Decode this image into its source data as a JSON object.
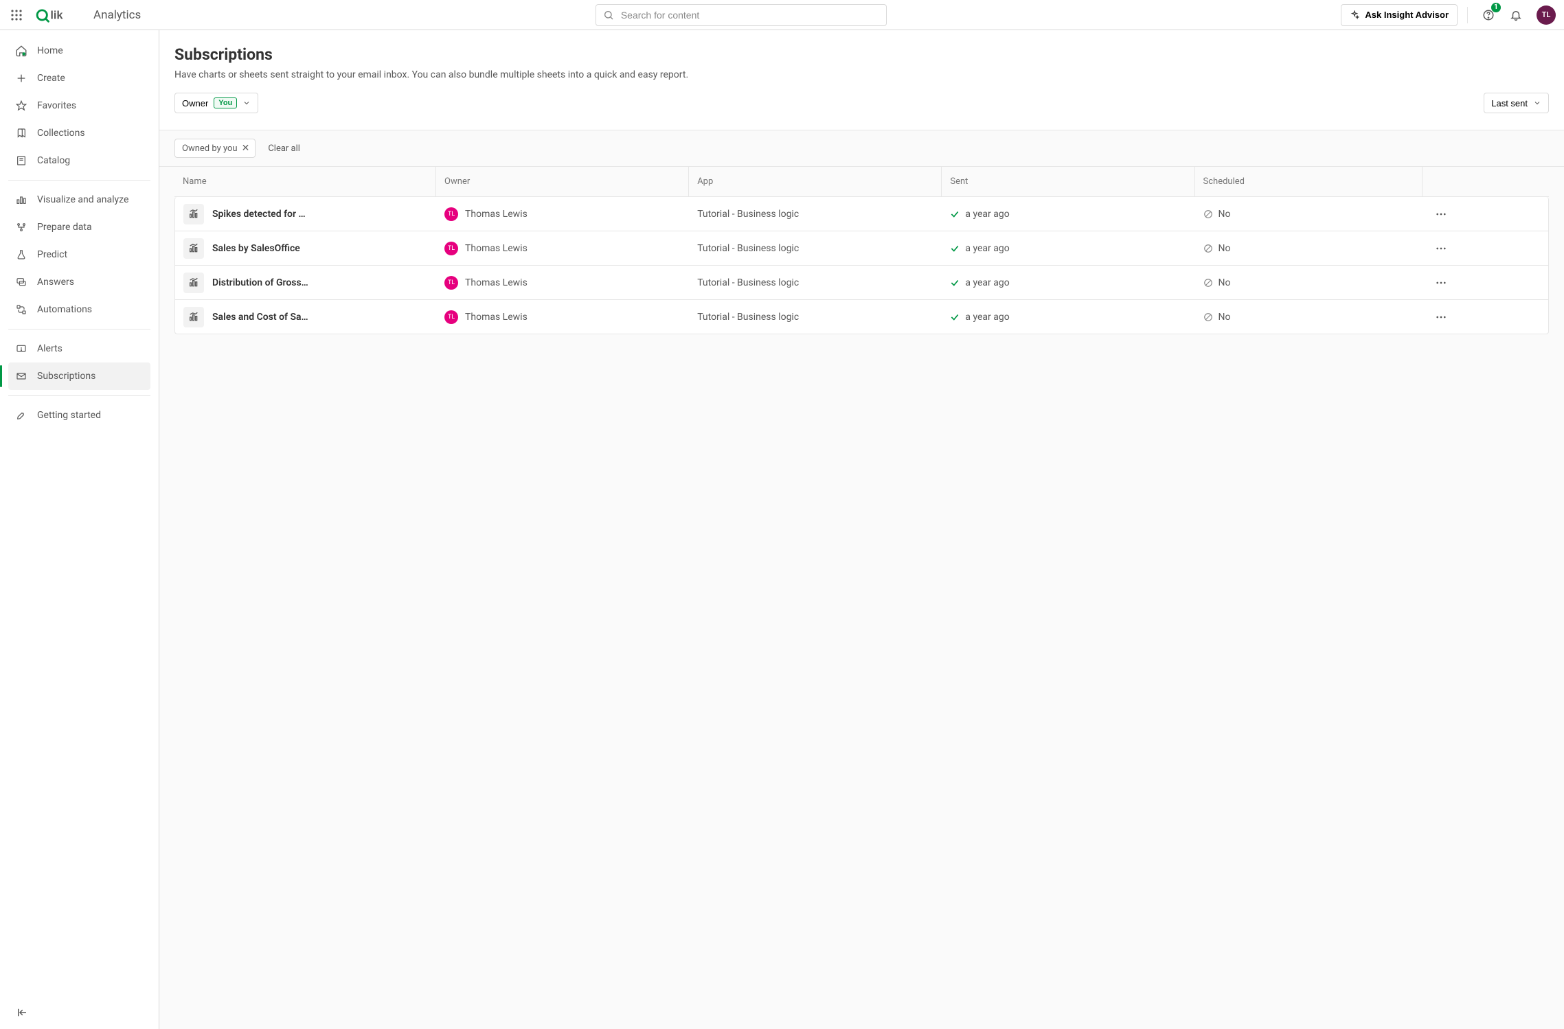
{
  "header": {
    "product": "Analytics",
    "search_placeholder": "Search for content",
    "ask_label": "Ask Insight Advisor",
    "notif_count": "1",
    "avatar_initials": "TL"
  },
  "sidebar": {
    "items": [
      {
        "id": "home",
        "label": "Home"
      },
      {
        "id": "create",
        "label": "Create"
      },
      {
        "id": "favorites",
        "label": "Favorites"
      },
      {
        "id": "collections",
        "label": "Collections"
      },
      {
        "id": "catalog",
        "label": "Catalog"
      },
      {
        "id": "visualize",
        "label": "Visualize and analyze"
      },
      {
        "id": "prepare",
        "label": "Prepare data"
      },
      {
        "id": "predict",
        "label": "Predict"
      },
      {
        "id": "answers",
        "label": "Answers"
      },
      {
        "id": "automations",
        "label": "Automations"
      },
      {
        "id": "alerts",
        "label": "Alerts"
      },
      {
        "id": "subscriptions",
        "label": "Subscriptions"
      },
      {
        "id": "getting",
        "label": "Getting started"
      }
    ]
  },
  "page": {
    "title": "Subscriptions",
    "subtitle": "Have charts or sheets sent straight to your email inbox. You can also bundle multiple sheets into a quick and easy report.",
    "filter_label": "Owner",
    "filter_badge": "You",
    "sort_label": "Last sent",
    "chip_label": "Owned by you",
    "clear_all": "Clear all"
  },
  "table": {
    "columns": {
      "name": "Name",
      "owner": "Owner",
      "app": "App",
      "sent": "Sent",
      "scheduled": "Scheduled"
    },
    "rows": [
      {
        "name": "Spikes detected for Cos…",
        "owner": "Thomas Lewis",
        "owner_initials": "TL",
        "app": "Tutorial - Business logic",
        "sent": "a year ago",
        "scheduled": "No"
      },
      {
        "name": "Sales by SalesOffice",
        "owner": "Thomas Lewis",
        "owner_initials": "TL",
        "app": "Tutorial - Business logic",
        "sent": "a year ago",
        "scheduled": "No"
      },
      {
        "name": "Distribution of Gross Pr…",
        "owner": "Thomas Lewis",
        "owner_initials": "TL",
        "app": "Tutorial - Business logic",
        "sent": "a year ago",
        "scheduled": "No"
      },
      {
        "name": "Sales and Cost of Sale …",
        "owner": "Thomas Lewis",
        "owner_initials": "TL",
        "app": "Tutorial - Business logic",
        "sent": "a year ago",
        "scheduled": "No"
      }
    ]
  }
}
